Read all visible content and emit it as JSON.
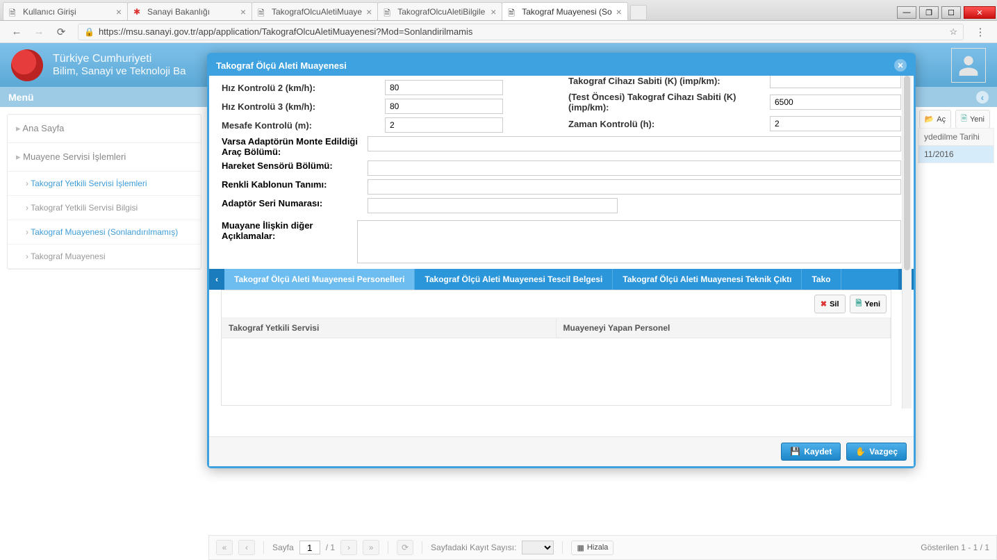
{
  "browser": {
    "tabs": [
      {
        "title": "Kullanıcı Girişi",
        "active": false,
        "fav": "page"
      },
      {
        "title": "Sanayi Bakanlığı",
        "active": false,
        "fav": "red"
      },
      {
        "title": "TakografOlcuAletiMuaye",
        "active": false,
        "fav": "page"
      },
      {
        "title": "TakografOlcuAletiBilgile",
        "active": false,
        "fav": "page"
      },
      {
        "title": "Takograf Muayenesi (So",
        "active": true,
        "fav": "page"
      }
    ],
    "url": "https://msu.sanayi.gov.tr/app/application/TakografOlcuAletiMuayenesi?Mod=Sonlandirilmamis"
  },
  "header": {
    "line1": "Türkiye Cumhuriyeti",
    "line2": "Bilim, Sanayi ve Teknoloji Ba"
  },
  "menu_label": "Menü",
  "sidebar": {
    "items": [
      {
        "label": "Ana Sayfa"
      },
      {
        "label": "Muayene Servisi İşlemleri"
      }
    ],
    "subs": [
      {
        "label": "Takograf Yetkili Servisi İşlemleri",
        "cls": "emph"
      },
      {
        "label": "Takograf Yetkili Servisi Bilgisi",
        "cls": "gray"
      },
      {
        "label": "Takograf Muayenesi (Sonlandırılmamış)",
        "cls": "emph"
      },
      {
        "label": "Takograf Muayenesi",
        "cls": "gray"
      }
    ]
  },
  "rightbar": {
    "ac": "Aç",
    "yeni": "Yeni",
    "col_header": "ydedilme Tarihi",
    "date_cell": "11/2016"
  },
  "modal": {
    "title": "Takograf Ölçü Aleti Muayenesi",
    "left": [
      {
        "label": "Hız Kontrolü 2 (km/h):",
        "value": "80"
      },
      {
        "label": "Hız Kontrolü 3 (km/h):",
        "value": "80"
      },
      {
        "label": "Mesafe Kontrolü (m):",
        "value": "2"
      }
    ],
    "right": [
      {
        "label": "Takograf Cihazı Sabiti (K) (imp/km):",
        "value": ""
      },
      {
        "label": "(Test Öncesi) Takograf Cihazı Sabiti (K) (imp/km):",
        "value": "6500"
      },
      {
        "label": "Zaman Kontrolü (h):",
        "value": "2"
      }
    ],
    "wide": [
      {
        "label": "Varsa Adaptörün Monte Edildiği Araç Bölümü:",
        "value": ""
      },
      {
        "label": "Hareket Sensörü Bölümü:",
        "value": ""
      },
      {
        "label": "Renkli Kablonun Tanımı:",
        "value": ""
      },
      {
        "label": "Adaptör Seri Numarası:",
        "value": ""
      }
    ],
    "memo_label": "Muayane İlişkin diğer Açıklamalar:",
    "memo_value": "",
    "tabs": [
      "Takograf Ölçü Aleti Muayenesi Personelleri",
      "Takograf Ölçü Aleti Muayenesi Tescil Belgesi",
      "Takograf Ölçü Aleti Muayenesi Teknik Çıktı",
      "Tako"
    ],
    "grid": {
      "btn_sil": "Sil",
      "btn_yeni": "Yeni",
      "cols": [
        "Takograf Yetkili Servisi",
        "Muayeneyi Yapan Personel"
      ]
    },
    "btn_kaydet": "Kaydet",
    "btn_vazgec": "Vazgeç"
  },
  "paging": {
    "label": "Sayfa",
    "page": "1",
    "total": "/ 1",
    "kayit": "Sayfadaki Kayıt Sayısı:",
    "hizala": "Hizala",
    "status": "Gösterilen 1 - 1 / 1"
  }
}
